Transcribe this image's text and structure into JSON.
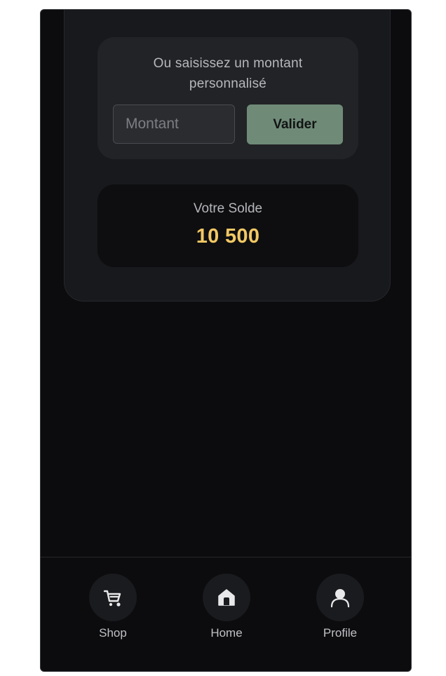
{
  "custom_amount": {
    "prompt": "Ou saisissez un montant personnalisé",
    "input_placeholder": "Montant",
    "submit_label": "Valider"
  },
  "balance": {
    "label": "Votre Solde",
    "value": "10 500",
    "value_color": "#f2c864"
  },
  "nav": {
    "items": [
      {
        "label": "Shop",
        "icon": "cart-icon"
      },
      {
        "label": "Home",
        "icon": "home-icon"
      },
      {
        "label": "Profile",
        "icon": "user-icon"
      }
    ]
  },
  "colors": {
    "background": "#0c0c0e",
    "card": "#18191c",
    "accent_button": "#6f8b78",
    "option_purple": "#a56ee6",
    "option_green": "#5fae80",
    "option_blue": "#5b82e6"
  }
}
